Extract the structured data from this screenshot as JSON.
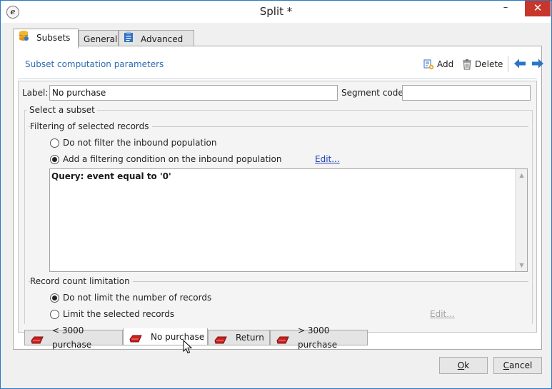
{
  "window": {
    "title": "Split *",
    "app_icon_letter": "e",
    "controls": {
      "minimize": "–",
      "maximize": "☐",
      "close": "✕"
    }
  },
  "tabs": [
    {
      "label": "Subsets",
      "icon": "database-icon",
      "active": true
    },
    {
      "label": "General",
      "active": false
    },
    {
      "label": "Advanced",
      "icon": "clipboard-icon",
      "active": false
    }
  ],
  "section": {
    "title": "Subset computation parameters",
    "add_label": "Add",
    "delete_label": "Delete"
  },
  "form": {
    "label_caption": "Label:",
    "label_value": "No purchase",
    "segment_caption": "Segment code:",
    "segment_value": "",
    "select_subset_title": "Select a subset",
    "filtering_title": "Filtering of selected records",
    "radio_no_filter": "Do not filter the inbound population",
    "radio_add_filter": "Add a filtering condition on the inbound population",
    "filter_selected": "add_filter",
    "edit_filter_link": "Edit...",
    "query_text": "Query: event equal to '0'",
    "limit_title": "Record count limitation",
    "radio_no_limit": "Do not limit the number of records",
    "radio_limit": "Limit the selected records",
    "limit_selected": "no_limit",
    "edit_limit_link": "Edit..."
  },
  "subset_tabs": [
    {
      "label": "< 3000 purchase",
      "active": false
    },
    {
      "label": "No purchase",
      "active": true
    },
    {
      "label": "Return",
      "active": false
    },
    {
      "label": "> 3000 purchase",
      "active": false
    }
  ],
  "buttons": {
    "ok_mnemonic": "O",
    "ok_rest": "k",
    "cancel_mnemonic": "C",
    "cancel_rest": "ancel"
  },
  "colors": {
    "accent": "#2d6bb3",
    "close_button": "#c7352b",
    "subset_icon": "#c9211e",
    "arrows": "#2a74c9"
  }
}
